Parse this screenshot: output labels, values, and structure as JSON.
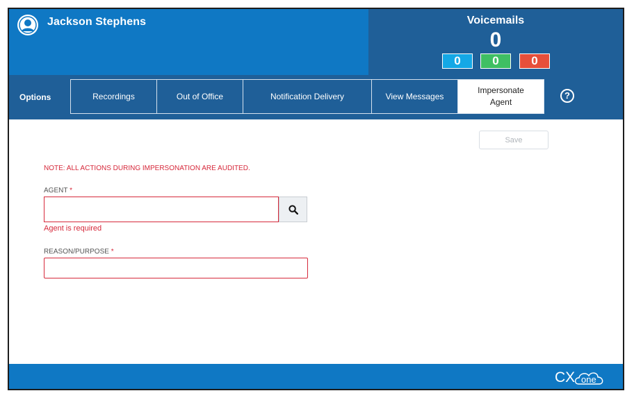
{
  "user": {
    "name": "Jackson Stephens"
  },
  "voicemails": {
    "title": "Voicemails",
    "total": "0",
    "counts": [
      {
        "value": "0",
        "color": "#14a8e6"
      },
      {
        "value": "0",
        "color": "#3fbf63"
      },
      {
        "value": "0",
        "color": "#e74f3a"
      }
    ]
  },
  "nav": {
    "options_label": "Options",
    "tabs": [
      {
        "label": "Recordings"
      },
      {
        "label": "Out of Office"
      },
      {
        "label": "Notification Delivery"
      },
      {
        "label": "View Messages"
      },
      {
        "label": "Impersonate Agent",
        "active": true
      }
    ],
    "help": "?"
  },
  "form": {
    "save_label": "Save",
    "note": "NOTE: ALL ACTIONS DURING IMPERSONATION ARE AUDITED.",
    "agent_label": "AGENT",
    "required_marker": "*",
    "agent_value": "",
    "agent_error": "Agent is required",
    "reason_label": "REASON/PURPOSE",
    "reason_value": ""
  },
  "footer": {
    "logo_text": "CXone"
  },
  "colors": {
    "header_blue": "#0f78c4",
    "nav_blue": "#1f5f98",
    "error_red": "#d6283a"
  }
}
